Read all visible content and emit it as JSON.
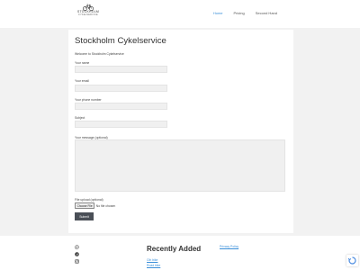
{
  "header": {
    "logo_line1": "STOCKHOLM",
    "logo_line2": "CYKELSERVICE",
    "nav": [
      {
        "label": "Home",
        "active": true
      },
      {
        "label": "Pricing",
        "active": false
      },
      {
        "label": "Second Hand",
        "active": false
      }
    ]
  },
  "main": {
    "title": "Stockholm Cykelservice",
    "intro": "Welcome to Stockholm Cykelservice",
    "fields": {
      "name_label": "Your name",
      "email_label": "Your email",
      "phone_label": "Your phone number",
      "subject_label": "Subject",
      "message_label": "Your message (optional)"
    },
    "file_upload_label": "File upload (optional)",
    "choose_file_label": "Choose File",
    "no_file_text": "No file chosen",
    "submit_label": "Submit"
  },
  "footer": {
    "social_icons": [
      "whatsapp-icon",
      "facebook-icon",
      "instagram-icon"
    ],
    "recent_title": "Recently Added",
    "recent_links": [
      "Cth bike",
      "Road bike"
    ],
    "privacy_label": "Privacy Policy"
  },
  "colors": {
    "accent": "#3a8fd9",
    "button": "#4a4f57",
    "page_bg": "#f2f2f2"
  }
}
